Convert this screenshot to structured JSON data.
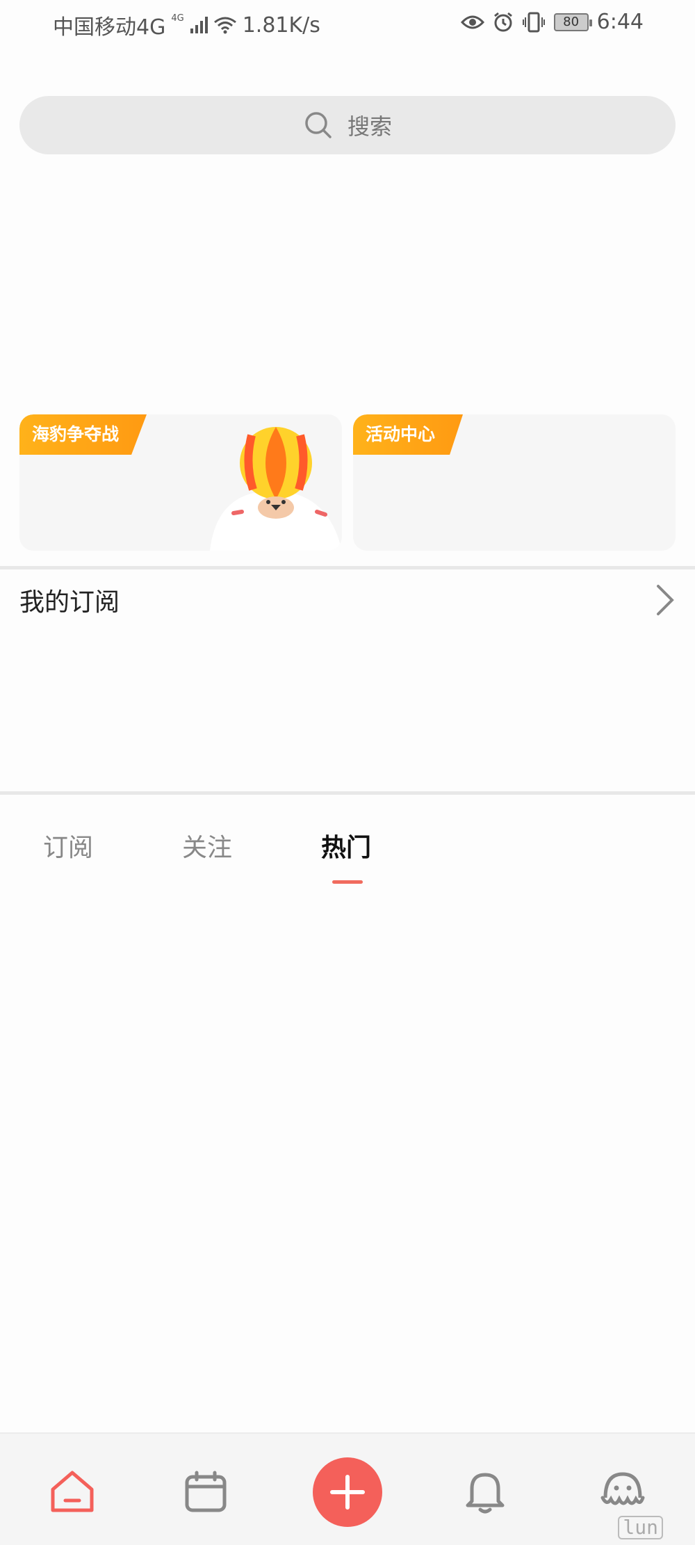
{
  "status_bar": {
    "carrier": "中国移动4G",
    "net_superscript": "4G",
    "speed": "1.81K/s",
    "battery": "80",
    "time": "6:44"
  },
  "search": {
    "placeholder": "搜索"
  },
  "cards": [
    {
      "tag": "海豹争夺战"
    },
    {
      "tag": "活动中心"
    }
  ],
  "subscriptions": {
    "title": "我的订阅"
  },
  "tabs": [
    {
      "label": "订阅",
      "active": false
    },
    {
      "label": "关注",
      "active": false
    },
    {
      "label": "热门",
      "active": true
    }
  ],
  "bottom_nav": {
    "items": [
      "home-icon",
      "calendar-icon",
      "add-icon",
      "bell-icon",
      "profile-icon"
    ],
    "accent_color": "#f4605a",
    "watermark": "lun"
  }
}
